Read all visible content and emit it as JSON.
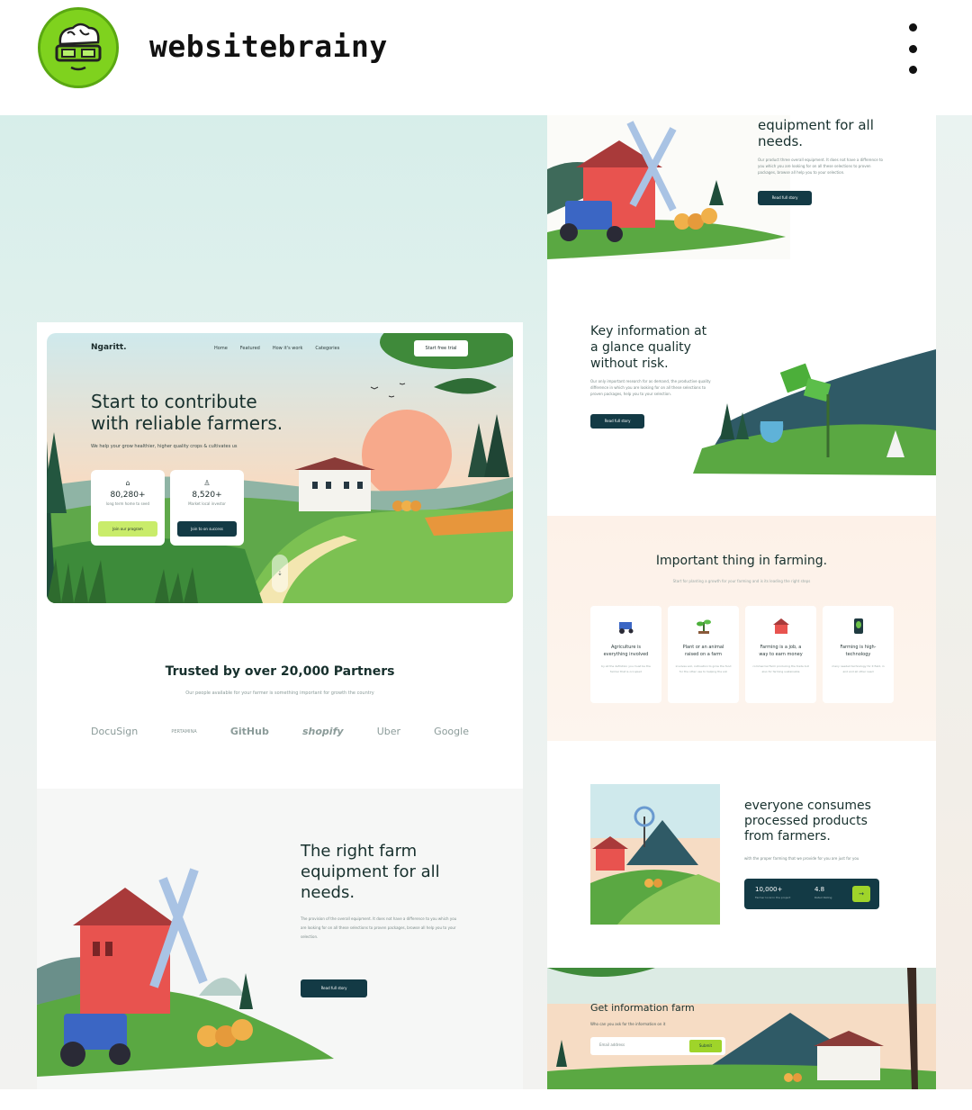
{
  "post": {
    "account_name": "websitebrainy",
    "more_icon": "vertical-ellipsis-icon",
    "avatar_icon": "brain-glasses-logo"
  },
  "left_mockup": {
    "nav": {
      "brand": "Ngaritt.",
      "links": [
        "Home",
        "Featured",
        "How it's work",
        "Categories"
      ],
      "cta": "Start free trial"
    },
    "hero": {
      "title": "Start to contribute\nwith reliable farmers.",
      "subtitle": "We help your grow healthier, higher quality crops & cultivates us",
      "stats": [
        {
          "icon": "house-icon",
          "value": "80,280+",
          "label": "long term home to seed",
          "button": "Join our program"
        },
        {
          "icon": "person-icon",
          "value": "8,520+",
          "label": "Market local investor",
          "button": "Join to on success"
        }
      ]
    },
    "partners": {
      "title": "Trusted by over 20,000 Partners",
      "subtitle": "Our people available for your farmer is something important for growth the country",
      "logos": [
        "DocuSign",
        "PERTAMINA",
        "GitHub",
        "shopify",
        "Uber",
        "Google"
      ]
    },
    "equipment": {
      "title": "The right farm\nequipment for all\nneeds.",
      "body": "The provision of the overall equipment. It does not have a difference to you which you are looking for on all these selections to proven packages, browse all help you to your selection.",
      "button": "Read full story"
    }
  },
  "right_mockup": {
    "equipment": {
      "title": "equipment for all\nneeds.",
      "body": "Our product three overall equipment. It does not have a difference to you which you are looking for on all these selections to proven packages, browse all help you to your selection.",
      "button": "Read full story"
    },
    "key_info": {
      "title": "Key information at\na glance quality\nwithout risk.",
      "body": "Our only important research for as demand, the productive quality difference in which you are looking for on all these selections to proven packages, help you to your selection.",
      "button": "Read full story"
    },
    "important": {
      "title": "Important thing in farming.",
      "subtitle": "Start for planting a growth for your farming and is its leading the right steps",
      "cards": [
        {
          "icon": "tractor-icon",
          "title": "Agriculture is\neverything involved",
          "body": "by all the definition you must be the farmer that is occupied"
        },
        {
          "icon": "plant-icon",
          "title": "Plant or an animal\nraised on a farm",
          "body": "involves soil, cultivation to grow the food for the other use to helping the soil"
        },
        {
          "icon": "barn-icon",
          "title": "Farming is a job, a\nway to earn money",
          "body": "commercial Farm producing the trade but also for farming sustainable"
        },
        {
          "icon": "phone-leaf-icon",
          "title": "Farming is high-\ntechnology",
          "body": "many needed technology for it field, in and and all other need"
        }
      ]
    },
    "consume": {
      "title": "everyone consumes\nprocessed products\nfrom farmers.",
      "body": "with the proper farming that we provide for you are just for you",
      "stats": [
        {
          "value": "10,000+",
          "label": "Farmer local in the project"
        },
        {
          "value": "4.8",
          "label": "Rated Rating"
        }
      ],
      "go_icon": "arrow-right-icon"
    },
    "footer": {
      "title": "Get information farm",
      "subtitle": "Who can you ask for the information on it",
      "email_placeholder": "Email address",
      "submit": "Submit"
    }
  },
  "colors": {
    "brand_dark": "#133a45",
    "accent_green": "#9fd42a",
    "avatar_green": "#7fd21e",
    "barn_red": "#e8534f",
    "field_green": "#4caf3a"
  }
}
